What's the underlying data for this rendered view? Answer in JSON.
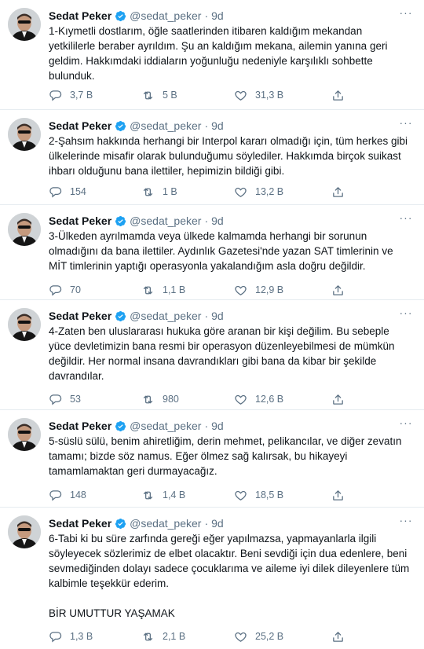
{
  "account": {
    "name": "Sedat Peker",
    "handle": "@sedat_peker",
    "separator": "·"
  },
  "more_glyph": "···",
  "colors": {
    "muted": "#5b7083",
    "verified": "#1da1f2",
    "border": "#e6ecf0"
  },
  "tweets": [
    {
      "time": "9d",
      "text": "1-Kıymetli dostlarım, öğle saatlerinden itibaren kaldığım mekandan\nyetkililerle beraber ayrıldım. Şu an kaldığım mekana, ailemin yanına geri\ngeldim. Hakkımdaki iddiaların yoğunluğu nedeniyle karşılıklı sohbette\nbulunduk.",
      "replies": "3,7 B",
      "retweets": "5 B",
      "likes": "31,3 B"
    },
    {
      "time": "9d",
      "text": "2-Şahsım hakkında herhangi bir Interpol kararı olmadığı için, tüm herkes gibi\nülkelerinde misafir olarak bulunduğumu söylediler. Hakkımda birçok suikast\nihbarı olduğunu bana ilettiler, hepimizin bildiği gibi.",
      "replies": "154",
      "retweets": "1 B",
      "likes": "13,2 B"
    },
    {
      "time": "9d",
      "text": "3-Ülkeden ayrılmamda veya ülkede kalmamda herhangi bir sorunun\nolmadığını da bana ilettiler. Aydınlık Gazetesi'nde yazan SAT timlerinin ve\nMİT timlerinin yaptığı operasyonla yakalandığım asla doğru değildir.",
      "replies": "70",
      "retweets": "1,1 B",
      "likes": "12,9 B"
    },
    {
      "time": "9d",
      "text": "4-Zaten ben uluslararası hukuka göre aranan bir kişi değilim. Bu sebeple\nyüce devletimizin bana resmi bir operasyon düzenleyebilmesi de mümkün\ndeğildir. Her normal insana davrandıkları gibi bana da kibar bir şekilde\ndavrandılar.",
      "replies": "53",
      "retweets": "980",
      "likes": "12,6 B"
    },
    {
      "time": "9d",
      "text": "5-süslü sülü, benim ahiretliğim, derin mehmet, pelikancılar, ve diğer zevatın\ntamamı; bizde söz namus. Eğer ölmez sağ kalırsak, bu hikayeyi\ntamamlamaktan geri durmayacağız.",
      "replies": "148",
      "retweets": "1,4 B",
      "likes": "18,5 B"
    },
    {
      "time": "9d",
      "text": "6-Tabi ki bu süre zarfında gereği eğer yapılmazsa, yapmayanlarla ilgili\nsöyleyecek sözlerimiz de elbet olacaktır. Beni sevdiği için dua edenlere, beni\nsevmediğinden dolayı sadece çocuklarıma ve aileme iyi dilek dileyenlere tüm\nkalbimle teşekkür ederim.\n\nBİR UMUTTUR YAŞAMAK",
      "replies": "1,3 B",
      "retweets": "2,1 B",
      "likes": "25,2 B"
    }
  ]
}
